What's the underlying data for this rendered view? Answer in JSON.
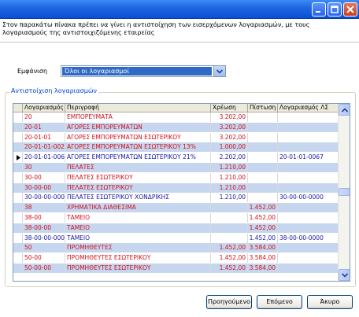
{
  "intro_text": "Στον παρακάτω πίνακα πρέπει να γίνει η αντιστοίχηση των εισερχόμενων λογαριασμών, με τους λογαριασμούς της αντιστοιχιζόμενης εταιρείας",
  "filter": {
    "label": "Εμφάνιση",
    "selected": "Όλοι οι λογαριασμοί"
  },
  "group_title": "Αντιστοίχιση λογαριασμών",
  "columns": [
    "Λογαριασμός",
    "Περιγραφή",
    "Χρέωση",
    "Πίστωση",
    "Λογαριασμός ΛΣ"
  ],
  "rows": [
    {
      "account": "20",
      "description": "ΕΜΠΟΡΕΥΜΑΤΑ",
      "debit": "3.202,00",
      "credit": "",
      "mapped": "",
      "color": "red"
    },
    {
      "account": "20-01",
      "description": "ΑΓΟΡΕΣ ΕΜΠΟΡΕΥΜΑΤΩΝ",
      "debit": "3.202,00",
      "credit": "",
      "mapped": "",
      "color": "red"
    },
    {
      "account": "20-01-01",
      "description": "ΑΓΟΡΕΣ ΕΜΠΟΡΕΥΜΑΤΩΝ ΕΣΩΤΕΡΙΚΟΥ",
      "debit": "3.202,00",
      "credit": "",
      "mapped": "",
      "color": "red"
    },
    {
      "account": "20-01-01-002",
      "description": "ΑΓΟΡΕΣ ΕΜΠΟΡΕΥΜΑΤΩΝ ΕΣΩΤΕΡΙΚΟΥ 13%",
      "debit": "1.000,00",
      "credit": "",
      "mapped": "",
      "color": "red"
    },
    {
      "account": "20-01-01-006",
      "description": "ΑΓΟΡΕΣ ΕΜΠΟΡΕΥΜΑΤΩΝ ΕΣΩΤΕΡΙΚΟΥ 21%",
      "debit": "2.202,00",
      "credit": "",
      "mapped": "20-01-01-0067",
      "color": "navy",
      "current": true
    },
    {
      "account": "30",
      "description": "ΠΕΛΑΤΕΣ",
      "debit": "1.210,00",
      "credit": "",
      "mapped": "",
      "color": "red"
    },
    {
      "account": "30-00",
      "description": "ΠΕΛΑΤΕΣ ΕΣΩΤΕΡΙΚΟΥ",
      "debit": "1.210,00",
      "credit": "",
      "mapped": "",
      "color": "red"
    },
    {
      "account": "30-00-00",
      "description": "ΠΕΛΑΤΕΣ ΕΣΩΤΕΡΙΚΟΥ",
      "debit": "1.210,00",
      "credit": "",
      "mapped": "",
      "color": "red"
    },
    {
      "account": "30-00-00-000",
      "description": "ΠΕΛΑΤΕΣ ΕΣΩΤΕΡΙΚΟΥ ΧΟΝΔΡΙΚΗΣ",
      "debit": "1.210,00",
      "credit": "",
      "mapped": "30-00-00-0000",
      "color": "navy"
    },
    {
      "account": "38",
      "description": "ΧΡΗΜΑΤΙΚΑ ΔΙΑΘΕΣΙΜΑ",
      "debit": "",
      "credit": "1.452,00",
      "mapped": "",
      "color": "red"
    },
    {
      "account": "38-00",
      "description": "ΤΑΜΕΙΟ",
      "debit": "",
      "credit": "1.452,00",
      "mapped": "",
      "color": "red"
    },
    {
      "account": "38-00-00",
      "description": "ΤΑΜΕΙΟ",
      "debit": "",
      "credit": "1.452,00",
      "mapped": "",
      "color": "red"
    },
    {
      "account": "38-00-00-000",
      "description": "ΤΑΜΕΙΟ",
      "debit": "",
      "credit": "1.452,00",
      "mapped": "38-00-00-0000",
      "color": "navy"
    },
    {
      "account": "50",
      "description": "ΠΡΟΜΗΘΕΥΤΕΣ",
      "debit": "1.452,00",
      "credit": "3.584,00",
      "mapped": "",
      "color": "red"
    },
    {
      "account": "50-00",
      "description": "ΠΡΟΜΗΘΕΥΤΕΣ ΕΣΩΤΕΡΙΚΟΥ",
      "debit": "1.452,00",
      "credit": "3.584,00",
      "mapped": "",
      "color": "red"
    },
    {
      "account": "50-00-00",
      "description": "ΠΡΟΜΗΘΕΥΤΕΣ ΕΣΩΤΕΡΙΚΟΥ",
      "debit": "1.452,00",
      "credit": "3.584,00",
      "mapped": "",
      "color": "red"
    }
  ],
  "buttons": {
    "prev": "Προηγούμενο",
    "next": "Επόμενο",
    "cancel": "Άκυρο"
  },
  "colors": {
    "red": "#d0101b",
    "navy": "#1a1aa0",
    "alt_row": "#c6d6ef",
    "titlebar": "#1f64e0"
  }
}
